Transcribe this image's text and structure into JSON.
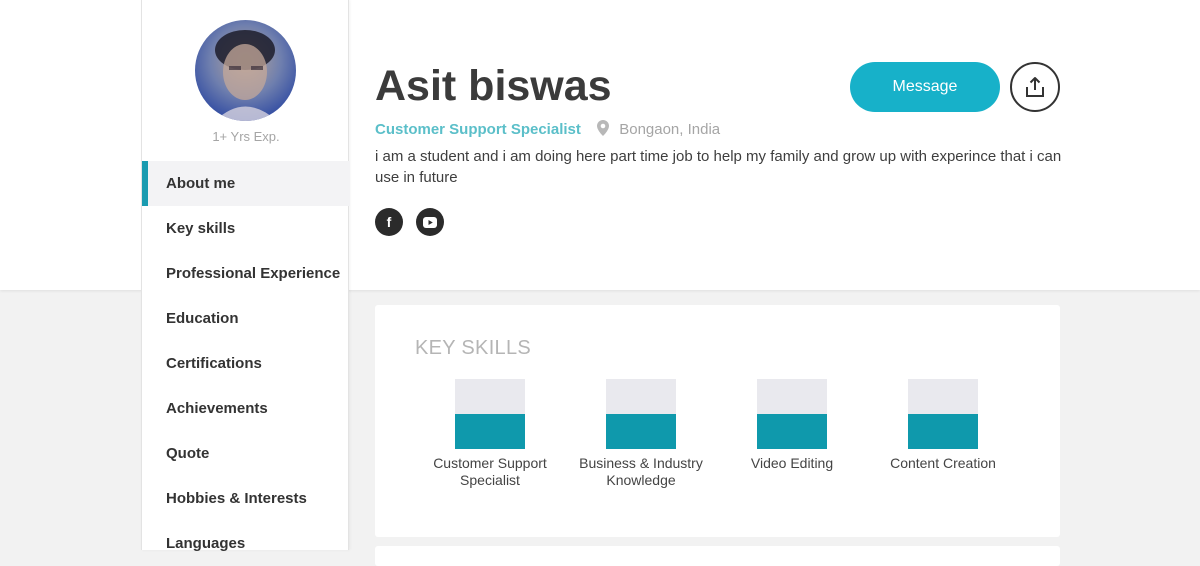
{
  "profile": {
    "name": "Asit biswas",
    "role": "Customer Support Specialist",
    "location": "Bongaon, India",
    "bio": "i am a student and i am doing here part time job to help my family and grow up with experince that i can use in future",
    "experience": "1+ Yrs Exp."
  },
  "actions": {
    "message_label": "Message",
    "share_icon": "share-icon"
  },
  "social": [
    {
      "icon": "facebook-icon",
      "glyph": "f"
    },
    {
      "icon": "youtube-icon"
    }
  ],
  "sidebar": {
    "items": [
      {
        "label": "About me",
        "active": true
      },
      {
        "label": "Key skills"
      },
      {
        "label": "Professional Experience"
      },
      {
        "label": "Education"
      },
      {
        "label": "Certifications"
      },
      {
        "label": "Achievements"
      },
      {
        "label": "Quote"
      },
      {
        "label": "Hobbies & Interests"
      },
      {
        "label": "Languages"
      }
    ]
  },
  "key_skills": {
    "title": "KEY SKILLS",
    "items": [
      {
        "label": "Customer Support Specialist",
        "level": 0.5
      },
      {
        "label": "Business & Industry Knowledge",
        "level": 0.5
      },
      {
        "label": "Video Editing",
        "level": 0.5
      },
      {
        "label": "Content Creation",
        "level": 0.5
      }
    ]
  },
  "colors": {
    "accent": "#17b1c9",
    "skill_fill": "#0f99ac",
    "role_text": "#5bbfc9"
  }
}
